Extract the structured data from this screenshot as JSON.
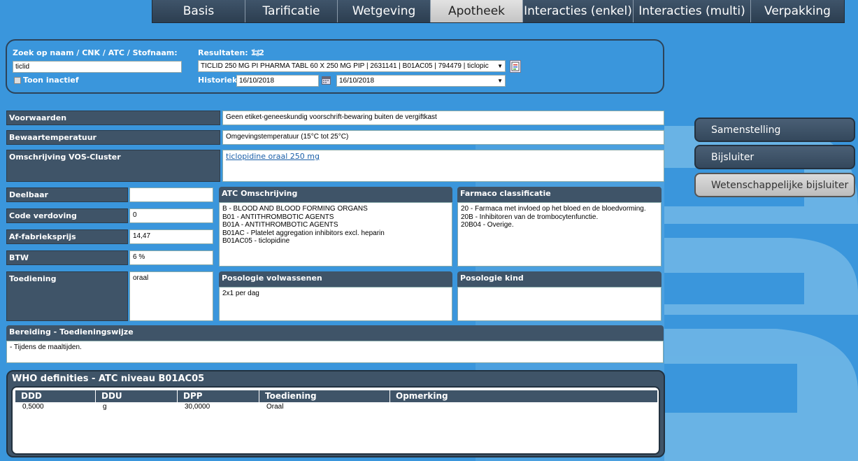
{
  "tabs": [
    {
      "label": "Basis",
      "active": false
    },
    {
      "label": "Tarificatie",
      "active": false
    },
    {
      "label": "Wetgeving",
      "active": false
    },
    {
      "label": "Apotheek",
      "active": true
    },
    {
      "label": "Interacties (enkel)",
      "active": false
    },
    {
      "label": "Interacties (multi)",
      "active": false
    },
    {
      "label": "Verpakking",
      "active": false
    }
  ],
  "search": {
    "label": "Zoek op naam / CNK / ATC / Stofnaam:",
    "value": "ticlid",
    "inactive_label": "Toon inactief",
    "results_label": "Resultaten: 1/2",
    "result_selected": "TICLID 250 MG PI PHARMA TABL 60 X 250 MG PIP | 2631141 | B01AC05 | 794479 | ticlopic",
    "history_label": "Historiek",
    "history_date": "16/10/2018",
    "history_select": "16/10/2018"
  },
  "fields": {
    "voorwaarden_label": "Voorwaarden",
    "voorwaarden_value": "Geen etiket-geneeskundig voorschrift-bewaring buiten de vergiftkast",
    "bewaartemp_label": "Bewaartemperatuur",
    "bewaartemp_value": "Omgevingstemperatuur (15°C tot 25°C)",
    "vos_label": "Omschrijving VOS-Cluster",
    "vos_value": "ticlopidine oraal 250 mg",
    "deelbaar_label": "Deelbaar",
    "deelbaar_value": "",
    "verdoving_label": "Code verdoving",
    "verdoving_value": "0",
    "prijs_label": "Af-fabrieksprijs",
    "prijs_value": "14,47",
    "btw_label": "BTW",
    "btw_value": "6 %",
    "toediening_label": "Toediening",
    "toediening_value": "oraal"
  },
  "atc": {
    "title": "ATC Omschrijving",
    "lines": [
      "B - BLOOD AND BLOOD FORMING ORGANS",
      "B01 - ANTITHROMBOTIC AGENTS",
      "B01A - ANTITHROMBOTIC AGENTS",
      "B01AC - Platelet aggregation inhibitors excl. heparin",
      "B01AC05 - ticlopidine"
    ]
  },
  "farmaco": {
    "title": "Farmaco classificatie",
    "lines": [
      "20 - Farmaca met invloed op het bloed en de bloedvorming.",
      "20B - Inhibitoren van de trombocytenfunctie.",
      "20B04 - Overige."
    ]
  },
  "posologie_volw": {
    "title": "Posologie volwassenen",
    "value": "2x1 per dag"
  },
  "posologie_kind": {
    "title": "Posologie kind",
    "value": ""
  },
  "bereiding": {
    "title": "Bereiding - Toedieningswijze",
    "value": "- Tijdens de maaltijden."
  },
  "right_buttons": [
    "Samenstelling",
    "Bijsluiter",
    "Wetenschappelijke bijsluiter"
  ],
  "who": {
    "title": "WHO definities - ATC niveau B01AC05",
    "headers": [
      "DDD",
      "DDU",
      "DPP",
      "Toediening",
      "Opmerking"
    ],
    "rows": [
      [
        "0,5000",
        "g",
        "30,0000",
        "Oraal",
        ""
      ]
    ]
  },
  "colors": {
    "background": "#3a96dc",
    "bar": "#3f5468",
    "active_tab": "#d4d4d4"
  }
}
